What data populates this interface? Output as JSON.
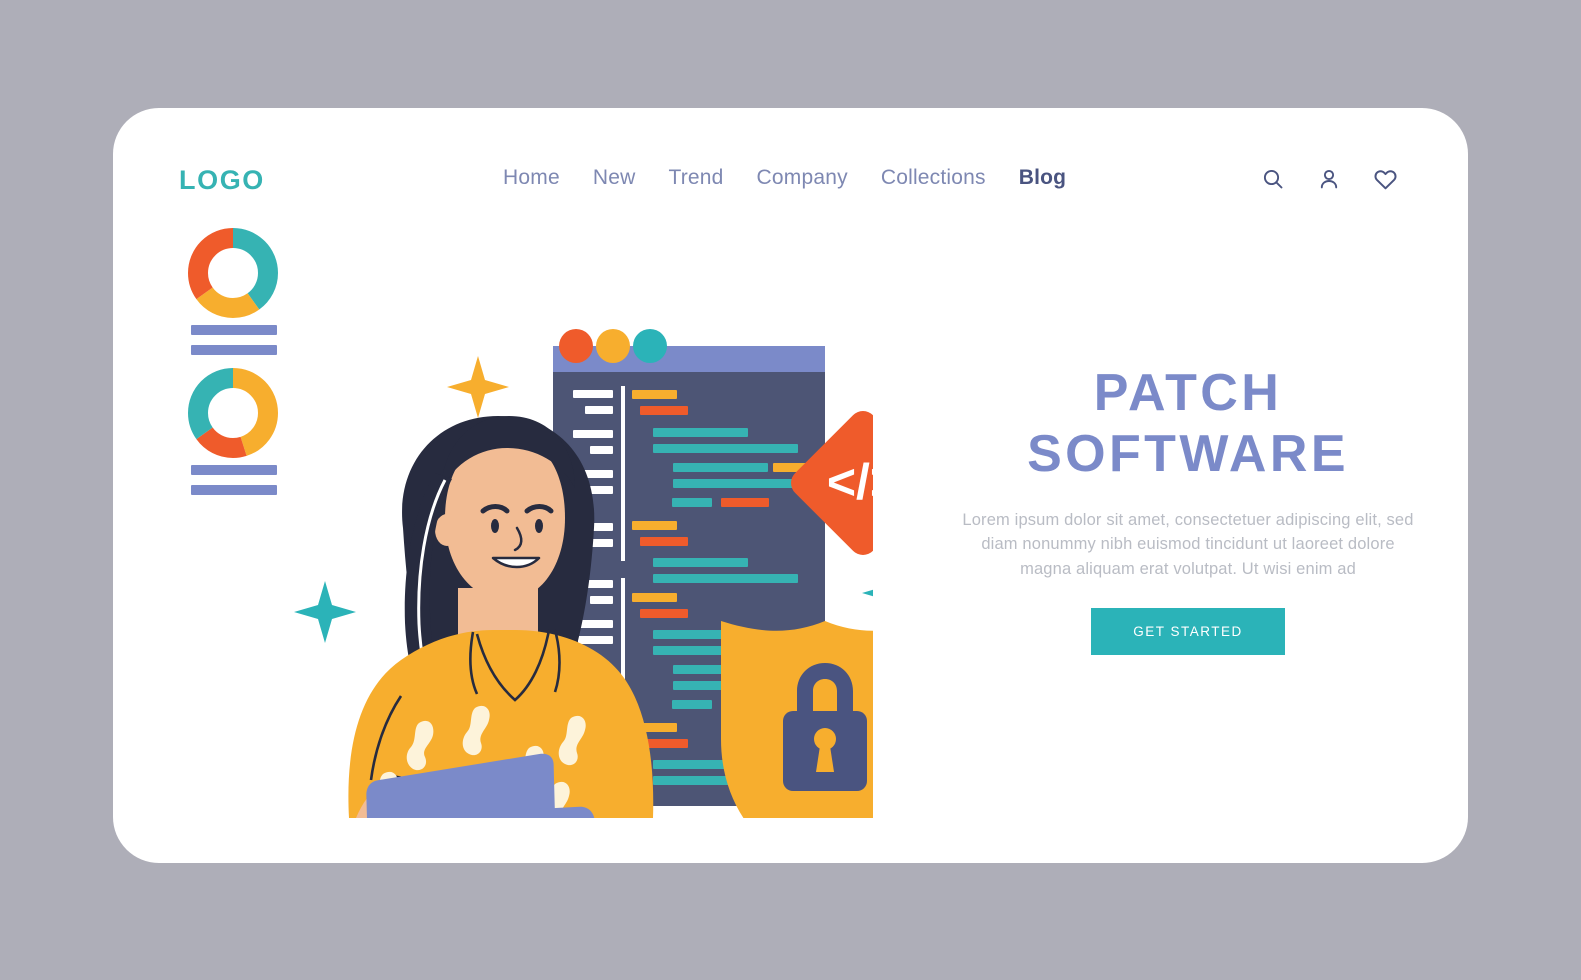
{
  "page": {
    "background_color": "#aeaeb8",
    "card_color": "#ffffff"
  },
  "header": {
    "logo": "LOGO",
    "logo_color": "#36b3b3",
    "nav": [
      {
        "label": "Home",
        "active": false
      },
      {
        "label": "New",
        "active": false
      },
      {
        "label": "Trend",
        "active": false
      },
      {
        "label": "Company",
        "active": false
      },
      {
        "label": "Collections",
        "active": false
      },
      {
        "label": "Blog",
        "active": true
      }
    ],
    "actions": [
      {
        "icon": "search-icon"
      },
      {
        "icon": "user-icon"
      },
      {
        "icon": "heart-icon"
      }
    ]
  },
  "hero": {
    "title_line1": "PATCH",
    "title_line2": "SOFTWARE",
    "title_color": "#7b8ac9",
    "body": "Lorem ipsum dolor sit amet, consectetuer adipiscing elit, sed diam nonummy nibh euismod tincidunt ut laoreet dolore magna aliquam erat volutpat. Ut wisi enim ad",
    "body_color": "#b9bcc4",
    "cta_label": "GET STARTED",
    "cta_color": "#2bb3b8"
  },
  "illustration": {
    "name": "patch-software-illustration",
    "colors": {
      "teal": "#36b3b3",
      "orange": "#ef5b2b",
      "yellow": "#f7ae2e",
      "periwinkle": "#7b8ac9",
      "slate": "#4a5480",
      "editor_bg": "#4d5575",
      "editor_bar": "#7b8ac9",
      "skin": "#f2bc94",
      "hair": "#272b3f",
      "blouse": "#f7ae2e",
      "leaf_light": "#a4c972",
      "leaf_dark": "#7a9e4e",
      "ground": "#1c2030"
    },
    "elements": [
      {
        "name": "donut-chart-top",
        "segments": [
          {
            "color": "#36b3b3",
            "value": 40
          },
          {
            "color": "#f7ae2e",
            "value": 25
          },
          {
            "color": "#ef5b2b",
            "value": 35
          }
        ]
      },
      {
        "name": "donut-chart-bottom",
        "segments": [
          {
            "color": "#f7ae2e",
            "value": 45
          },
          {
            "color": "#ef5b2b",
            "value": 20
          },
          {
            "color": "#36b3b3",
            "value": 35
          }
        ]
      },
      {
        "name": "code-editor-window",
        "dots": [
          "#ef5b2b",
          "#f7ae2e",
          "#36b3b3"
        ]
      },
      {
        "name": "code-badge",
        "symbol": "</>"
      },
      {
        "name": "security-shield",
        "icon": "padlock-icon"
      },
      {
        "name": "laptop"
      },
      {
        "name": "person-developer"
      },
      {
        "name": "plant-sprig"
      },
      {
        "name": "sparkle-yellow"
      },
      {
        "name": "sparkle-teal-left"
      },
      {
        "name": "sparkle-teal-right"
      }
    ]
  }
}
